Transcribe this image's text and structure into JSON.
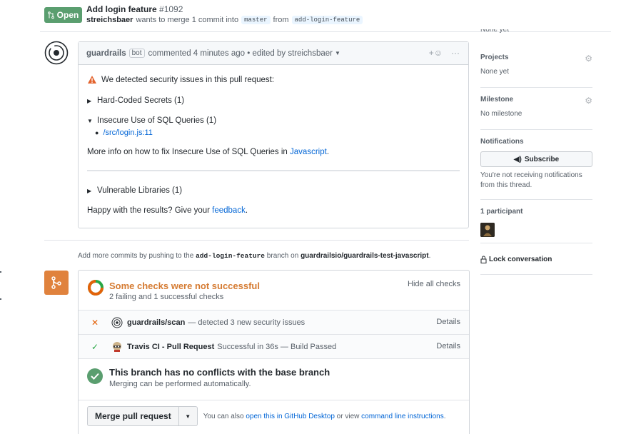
{
  "header": {
    "state": "Open",
    "title": "Add login feature",
    "number": "#1092",
    "author": "streichsbaer",
    "merge_text": "wants to merge 1 commit into",
    "base_branch": "master",
    "from_text": "from",
    "head_branch": "add-login-feature"
  },
  "comment": {
    "author": "guardrails",
    "bot_label": "bot",
    "meta": "commented 4 minutes ago • edited by streichsbaer",
    "warning": "We detected security issues in this pull request:",
    "sections": {
      "hardcoded": "Hard-Coded Secrets (1)",
      "sql": "Insecure Use of SQL Queries (1)",
      "sql_file": "/src/login.js:11",
      "more_info": "More info on how to fix Insecure Use of SQL Queries in",
      "more_info_link": "Javascript",
      "vulnerable": "Vulnerable Libraries (1)"
    },
    "happy": "Happy with the results? Give your",
    "feedback_link": "feedback"
  },
  "push_note": {
    "prefix": "Add more commits by pushing to the",
    "branch": "add-login-feature",
    "middle": "branch on",
    "repo": "guardrailsio/guardrails-test-javascript"
  },
  "checks": {
    "title": "Some checks were not successful",
    "subtitle": "2 failing and 1 successful checks",
    "hide_label": "Hide all checks",
    "rows": [
      {
        "status": "✕",
        "name": "guardrails/scan",
        "desc": "— detected 3 new security issues",
        "details": "Details",
        "status_color": "#e36209"
      },
      {
        "status": "✓",
        "name": "Travis CI - Pull Request",
        "desc": "Successful in 36s — Build Passed",
        "details": "Details",
        "status_color": "#28a745"
      }
    ]
  },
  "conflict": {
    "title": "This branch has no conflicts with the base branch",
    "subtitle": "Merging can be performed automatically."
  },
  "merge": {
    "button": "Merge pull request",
    "alt_prefix": "You can also",
    "alt_link1": "open this in GitHub Desktop",
    "alt_middle": "or view",
    "alt_link2": "command line instructions"
  },
  "sidebar": {
    "cut_text": "None yet",
    "projects_heading": "Projects",
    "projects_value": "None yet",
    "milestone_heading": "Milestone",
    "milestone_value": "No milestone",
    "notifications_heading": "Notifications",
    "subscribe_label": "Subscribe",
    "notifications_text": "You're not receiving notifications from this thread.",
    "participants_heading": "1 participant",
    "lock_label": "Lock conversation"
  },
  "colors": {
    "open_green": "#5a9e6f",
    "warning_orange": "#d57b32",
    "link_blue": "#0366d6"
  }
}
